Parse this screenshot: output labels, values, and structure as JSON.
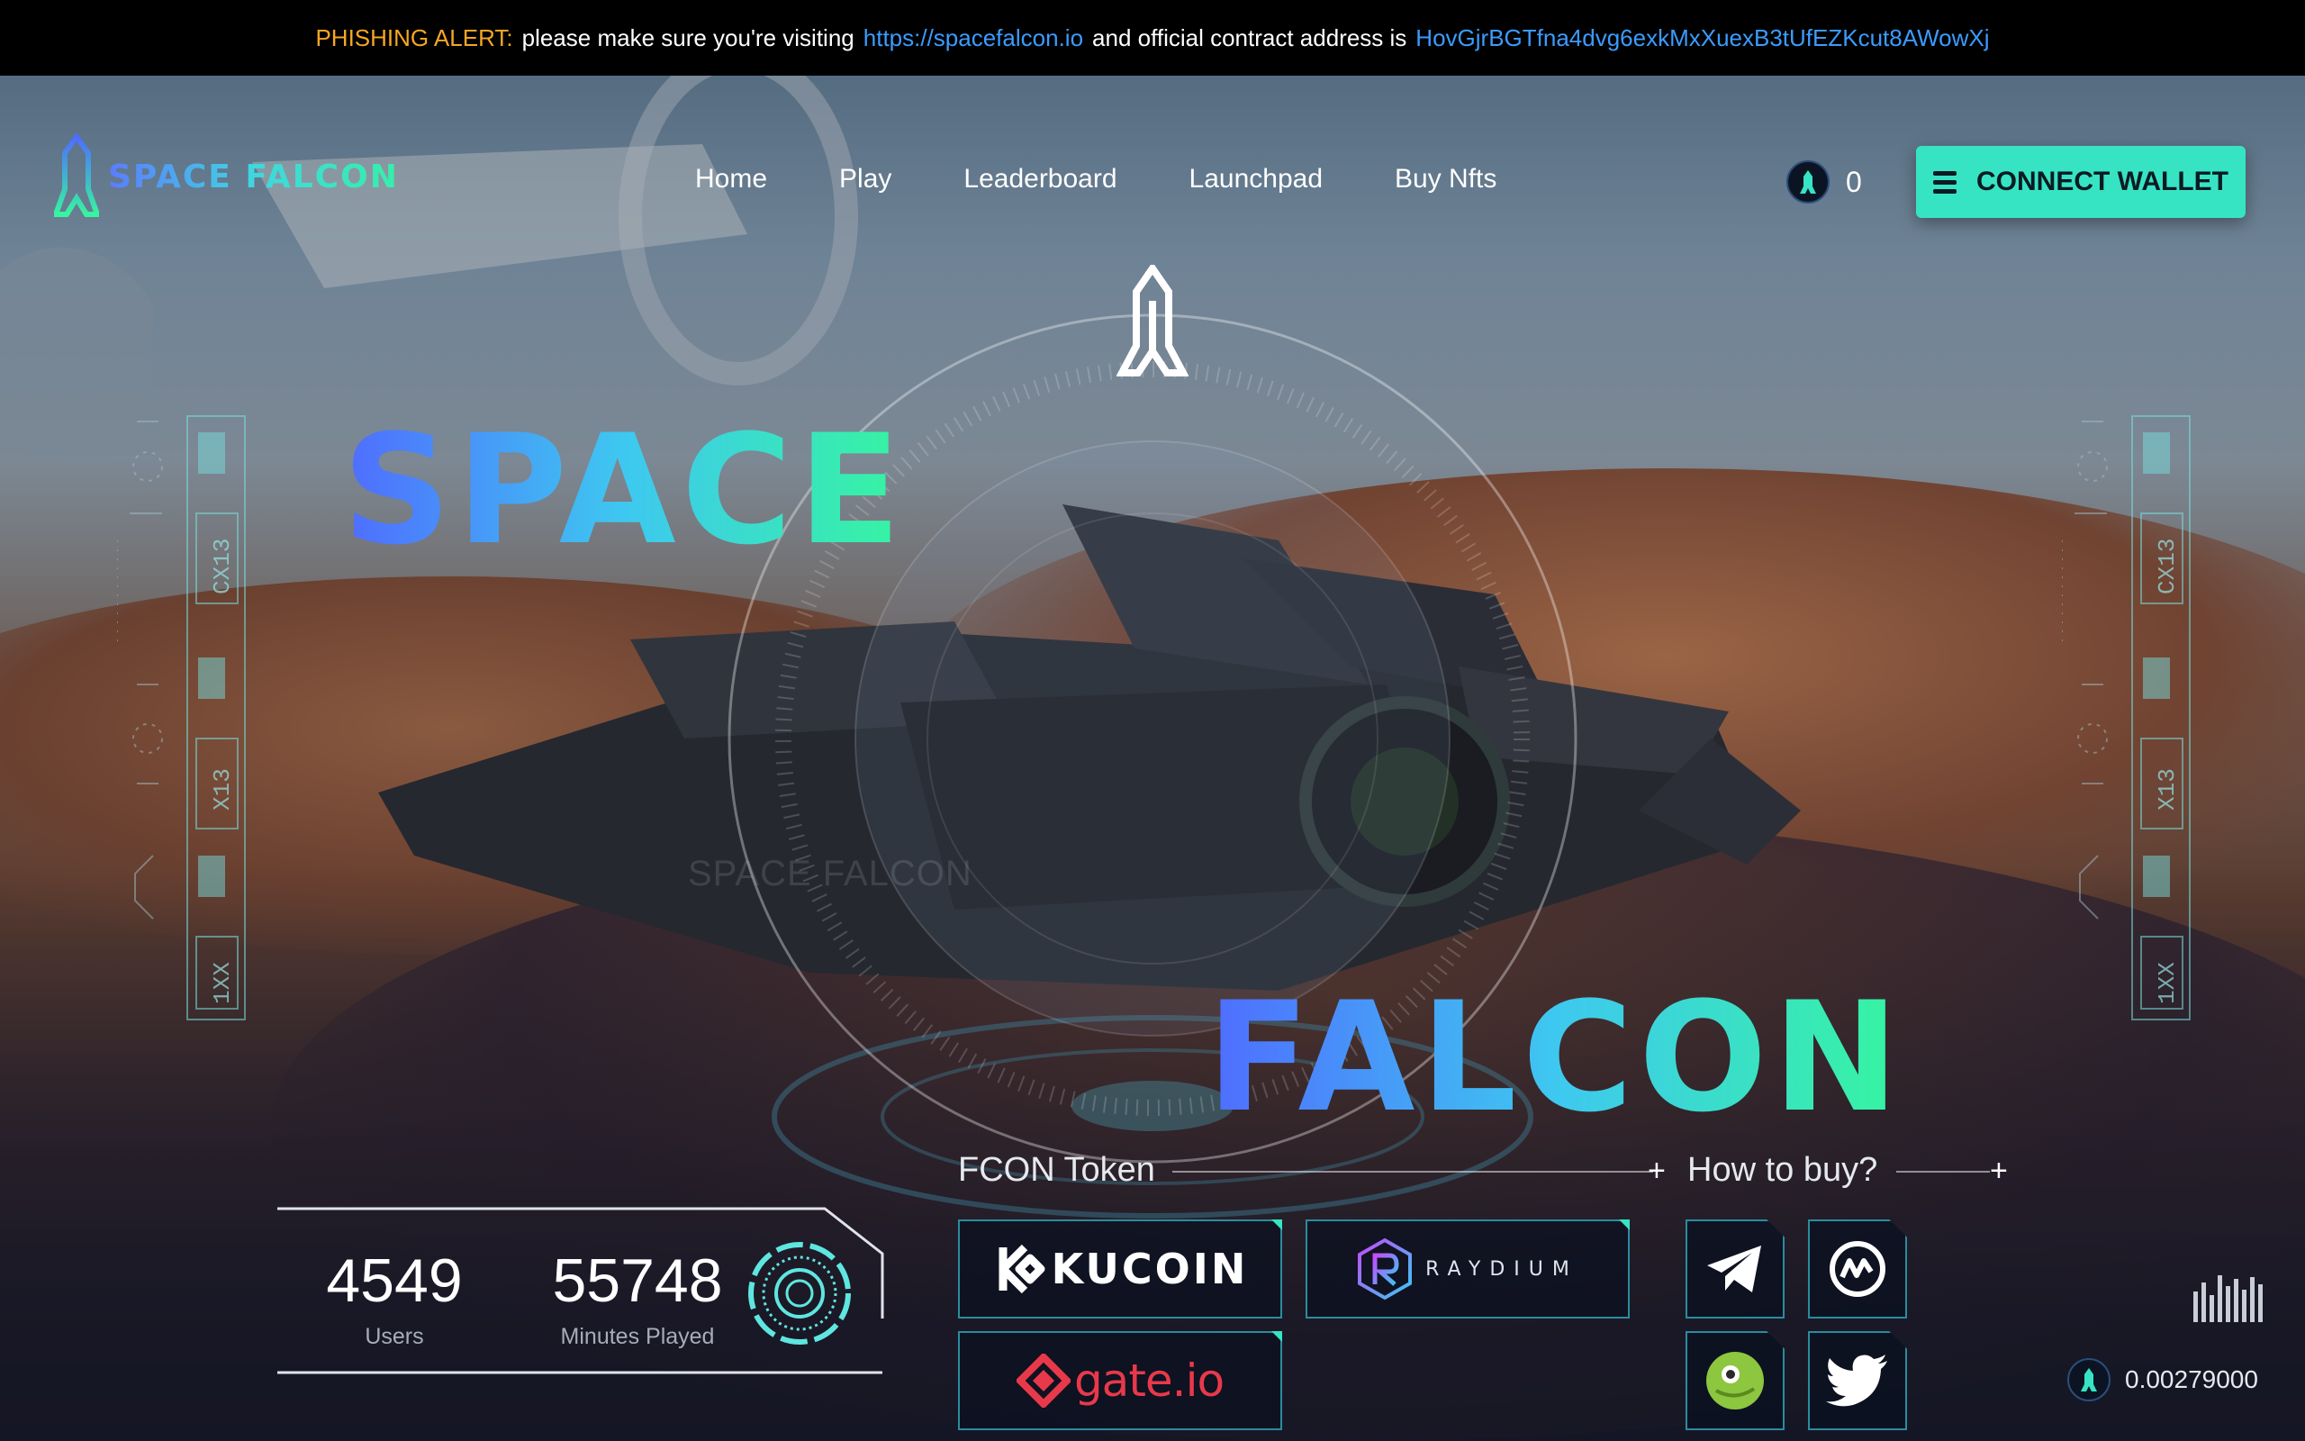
{
  "alert": {
    "label": "PHISHING ALERT:",
    "text1": "please make sure you're visiting",
    "site_link": "https://spacefalcon.io",
    "text2": "and official contract address is",
    "contract": "HovGjrBGTfna4dvg6exkMxXuexB3tUfEZKcut8AWowXj"
  },
  "brand": {
    "logo_text": "SPACE FALCON",
    "hero_word_1": "SPACE",
    "hero_word_2": "FALCON",
    "watermark": "SPACE FALCON"
  },
  "nav": {
    "items": [
      "Home",
      "Play",
      "Leaderboard",
      "Launchpad",
      "Buy Nfts"
    ]
  },
  "header": {
    "token_balance": "0",
    "connect_label": "CONNECT WALLET"
  },
  "stats": {
    "users_value": "4549",
    "users_label": "Users",
    "minutes_value": "55748",
    "minutes_label": "Minutes Played"
  },
  "token_section": {
    "title": "FCON Token",
    "exchanges": [
      {
        "name": "KUCOIN",
        "icon": "kucoin-logo"
      },
      {
        "name": "RAYDIUM",
        "icon": "raydium-logo"
      },
      {
        "name": "gate.io",
        "icon": "gateio-logo"
      }
    ]
  },
  "howtobuy": {
    "title": "How to buy?",
    "socials": [
      "telegram-icon",
      "coinmarketcap-icon",
      "coingecko-icon",
      "twitter-icon"
    ]
  },
  "price": {
    "value": "0.00279000"
  },
  "hud_labels": [
    "CX13",
    "X13",
    "1XX"
  ],
  "colors": {
    "accent": "#36e4c4",
    "alert_orange": "#f5a623",
    "link_blue": "#3b9bff",
    "gradient_start": "#4f6cff",
    "gradient_end": "#36f5a0"
  }
}
